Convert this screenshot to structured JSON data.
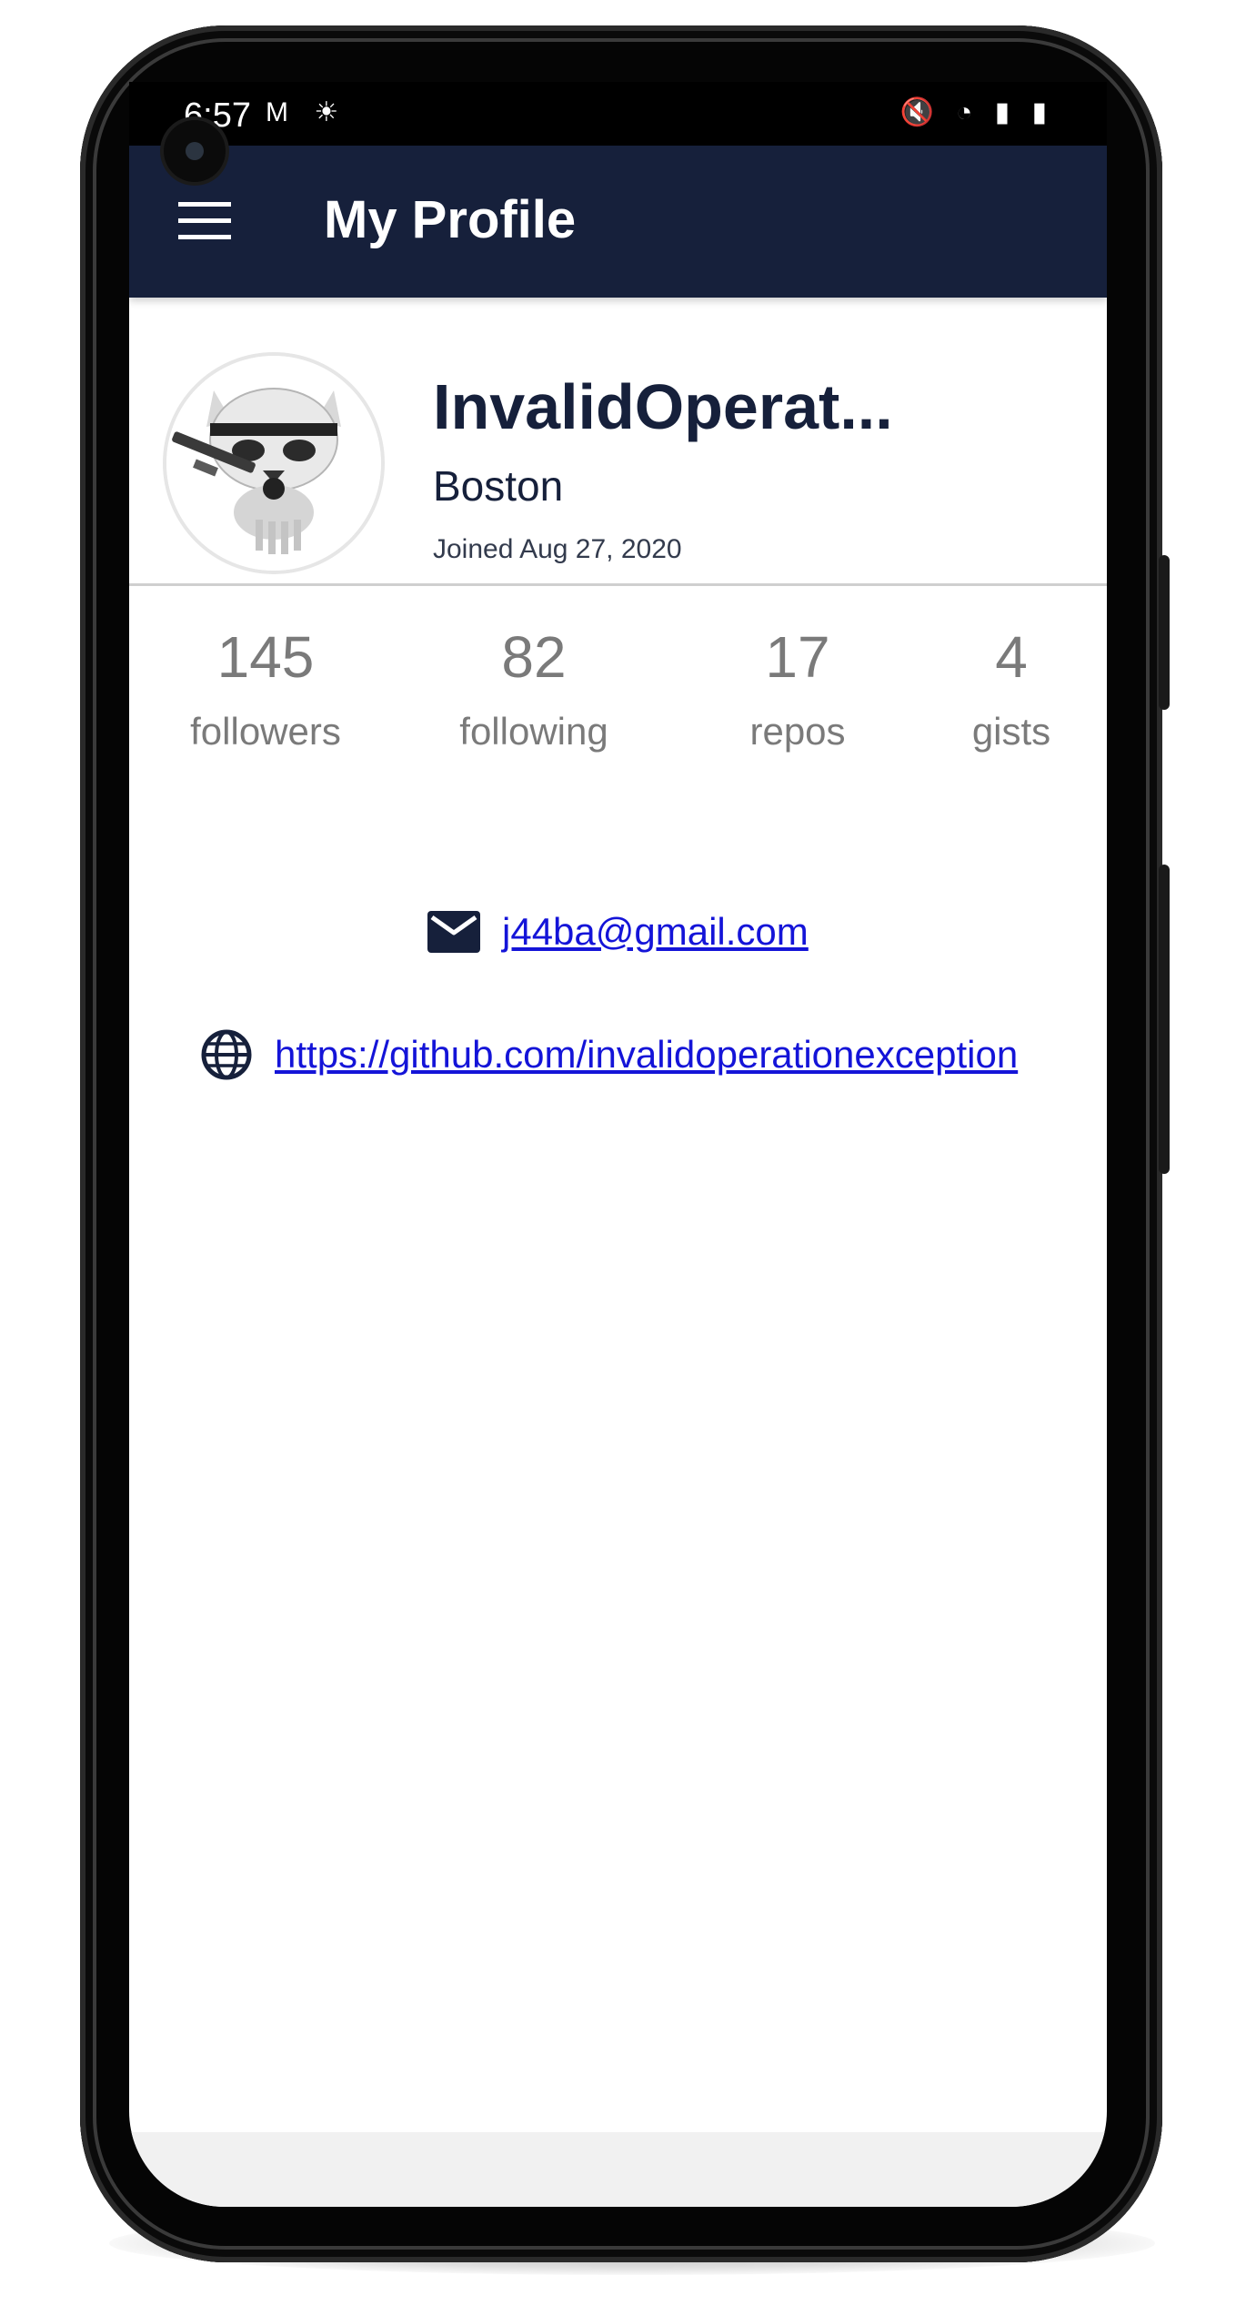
{
  "status_bar": {
    "time": "6:57",
    "left_icons": [
      "gmail-icon",
      "weather-icon"
    ],
    "right_icons": [
      "mute-icon",
      "wifi-icon",
      "signal-icon",
      "battery-icon"
    ]
  },
  "appbar": {
    "title": "My Profile",
    "menu_icon": "hamburger-menu-icon"
  },
  "profile": {
    "name": "InvalidOperat...",
    "location": "Boston",
    "joined": "Joined Aug 27, 2020",
    "avatar": "stormtroopocat-avatar"
  },
  "stats": [
    {
      "value": "145",
      "label": "followers"
    },
    {
      "value": "82",
      "label": "following"
    },
    {
      "value": "17",
      "label": "repos"
    },
    {
      "value": "4",
      "label": "gists"
    }
  ],
  "contact": {
    "email": "j44ba@gmail.com",
    "website": "https://github.com/invalidoperationexception"
  },
  "colors": {
    "appbar": "#16203b",
    "text_dark": "#16203b",
    "link": "#1414d8",
    "stat_gray": "#7a7a7a"
  }
}
